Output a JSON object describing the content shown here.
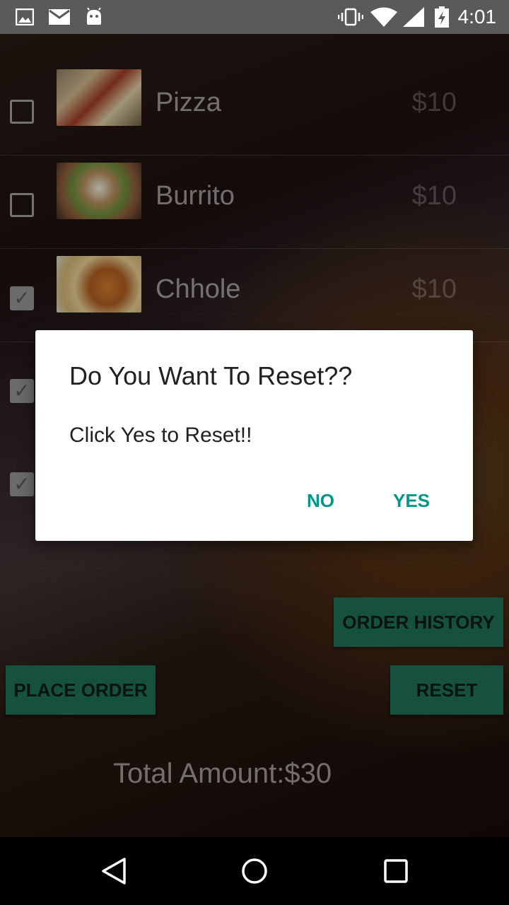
{
  "status": {
    "time": "4:01",
    "icons": [
      "image-icon",
      "mail-icon",
      "android-icon",
      "vibrate-icon",
      "wifi-icon",
      "signal-icon",
      "battery-charging-icon"
    ]
  },
  "menu": {
    "items": [
      {
        "name": "Pizza",
        "price": "$10",
        "checked": false
      },
      {
        "name": "Burrito",
        "price": "$10",
        "checked": false
      },
      {
        "name": "Chhole",
        "price": "$10",
        "checked": true
      }
    ]
  },
  "buttons": {
    "order_history": "ORDER HISTORY",
    "place_order": "PLACE ORDER",
    "reset": "RESET"
  },
  "total": "Total Amount:$30",
  "dialog": {
    "title": "Do You Want To Reset??",
    "message": "Click Yes to Reset!!",
    "no": "NO",
    "yes": "YES"
  },
  "nav": {
    "icons": [
      "back-icon",
      "home-icon",
      "recents-icon"
    ]
  }
}
